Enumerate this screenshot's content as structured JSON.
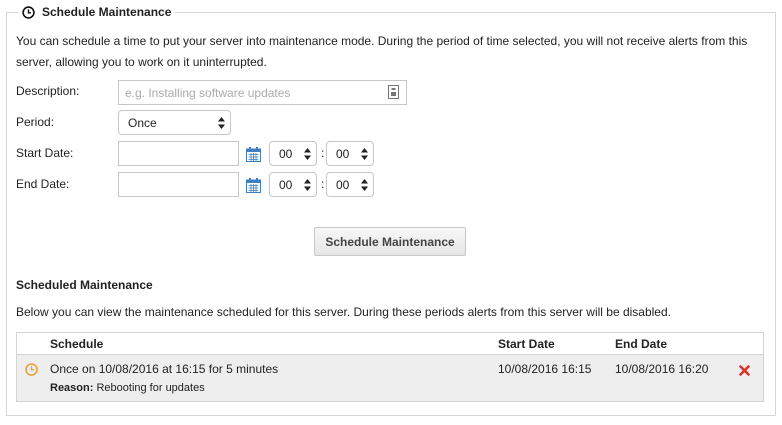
{
  "panel": {
    "title": "Schedule Maintenance",
    "intro": "You can schedule a time to put your server into maintenance mode. During the period of time selected, you will not receive alerts from this server, allowing you to work on it uninterrupted."
  },
  "form": {
    "description_label": "Description:",
    "description_placeholder": "e.g. Installing software updates",
    "description_value": "",
    "period_label": "Period:",
    "period_value": "Once",
    "start_label": "Start Date:",
    "start_value": "",
    "start_hour": "00",
    "start_minute": "00",
    "end_label": "End Date:",
    "end_value": "",
    "end_hour": "00",
    "end_minute": "00",
    "time_separator": ":",
    "submit_label": "Schedule Maintenance"
  },
  "scheduled": {
    "title": "Scheduled Maintenance",
    "description": "Below you can view the maintenance scheduled for this server. During these periods alerts from this server will be disabled.",
    "columns": {
      "schedule": "Schedule",
      "start": "Start Date",
      "end": "End Date"
    },
    "rows": [
      {
        "schedule": "Once on 10/08/2016 at 16:15 for 5 minutes",
        "reason_label": "Reason:",
        "reason": "Rebooting for updates",
        "start": "10/08/2016 16:15",
        "end": "10/08/2016 16:20"
      }
    ]
  },
  "colors": {
    "clock_icon": "#e8a23a",
    "delete_icon": "#d9342b",
    "calendar_icon": "#3f7fbf",
    "row_background": "#eeeeee"
  }
}
